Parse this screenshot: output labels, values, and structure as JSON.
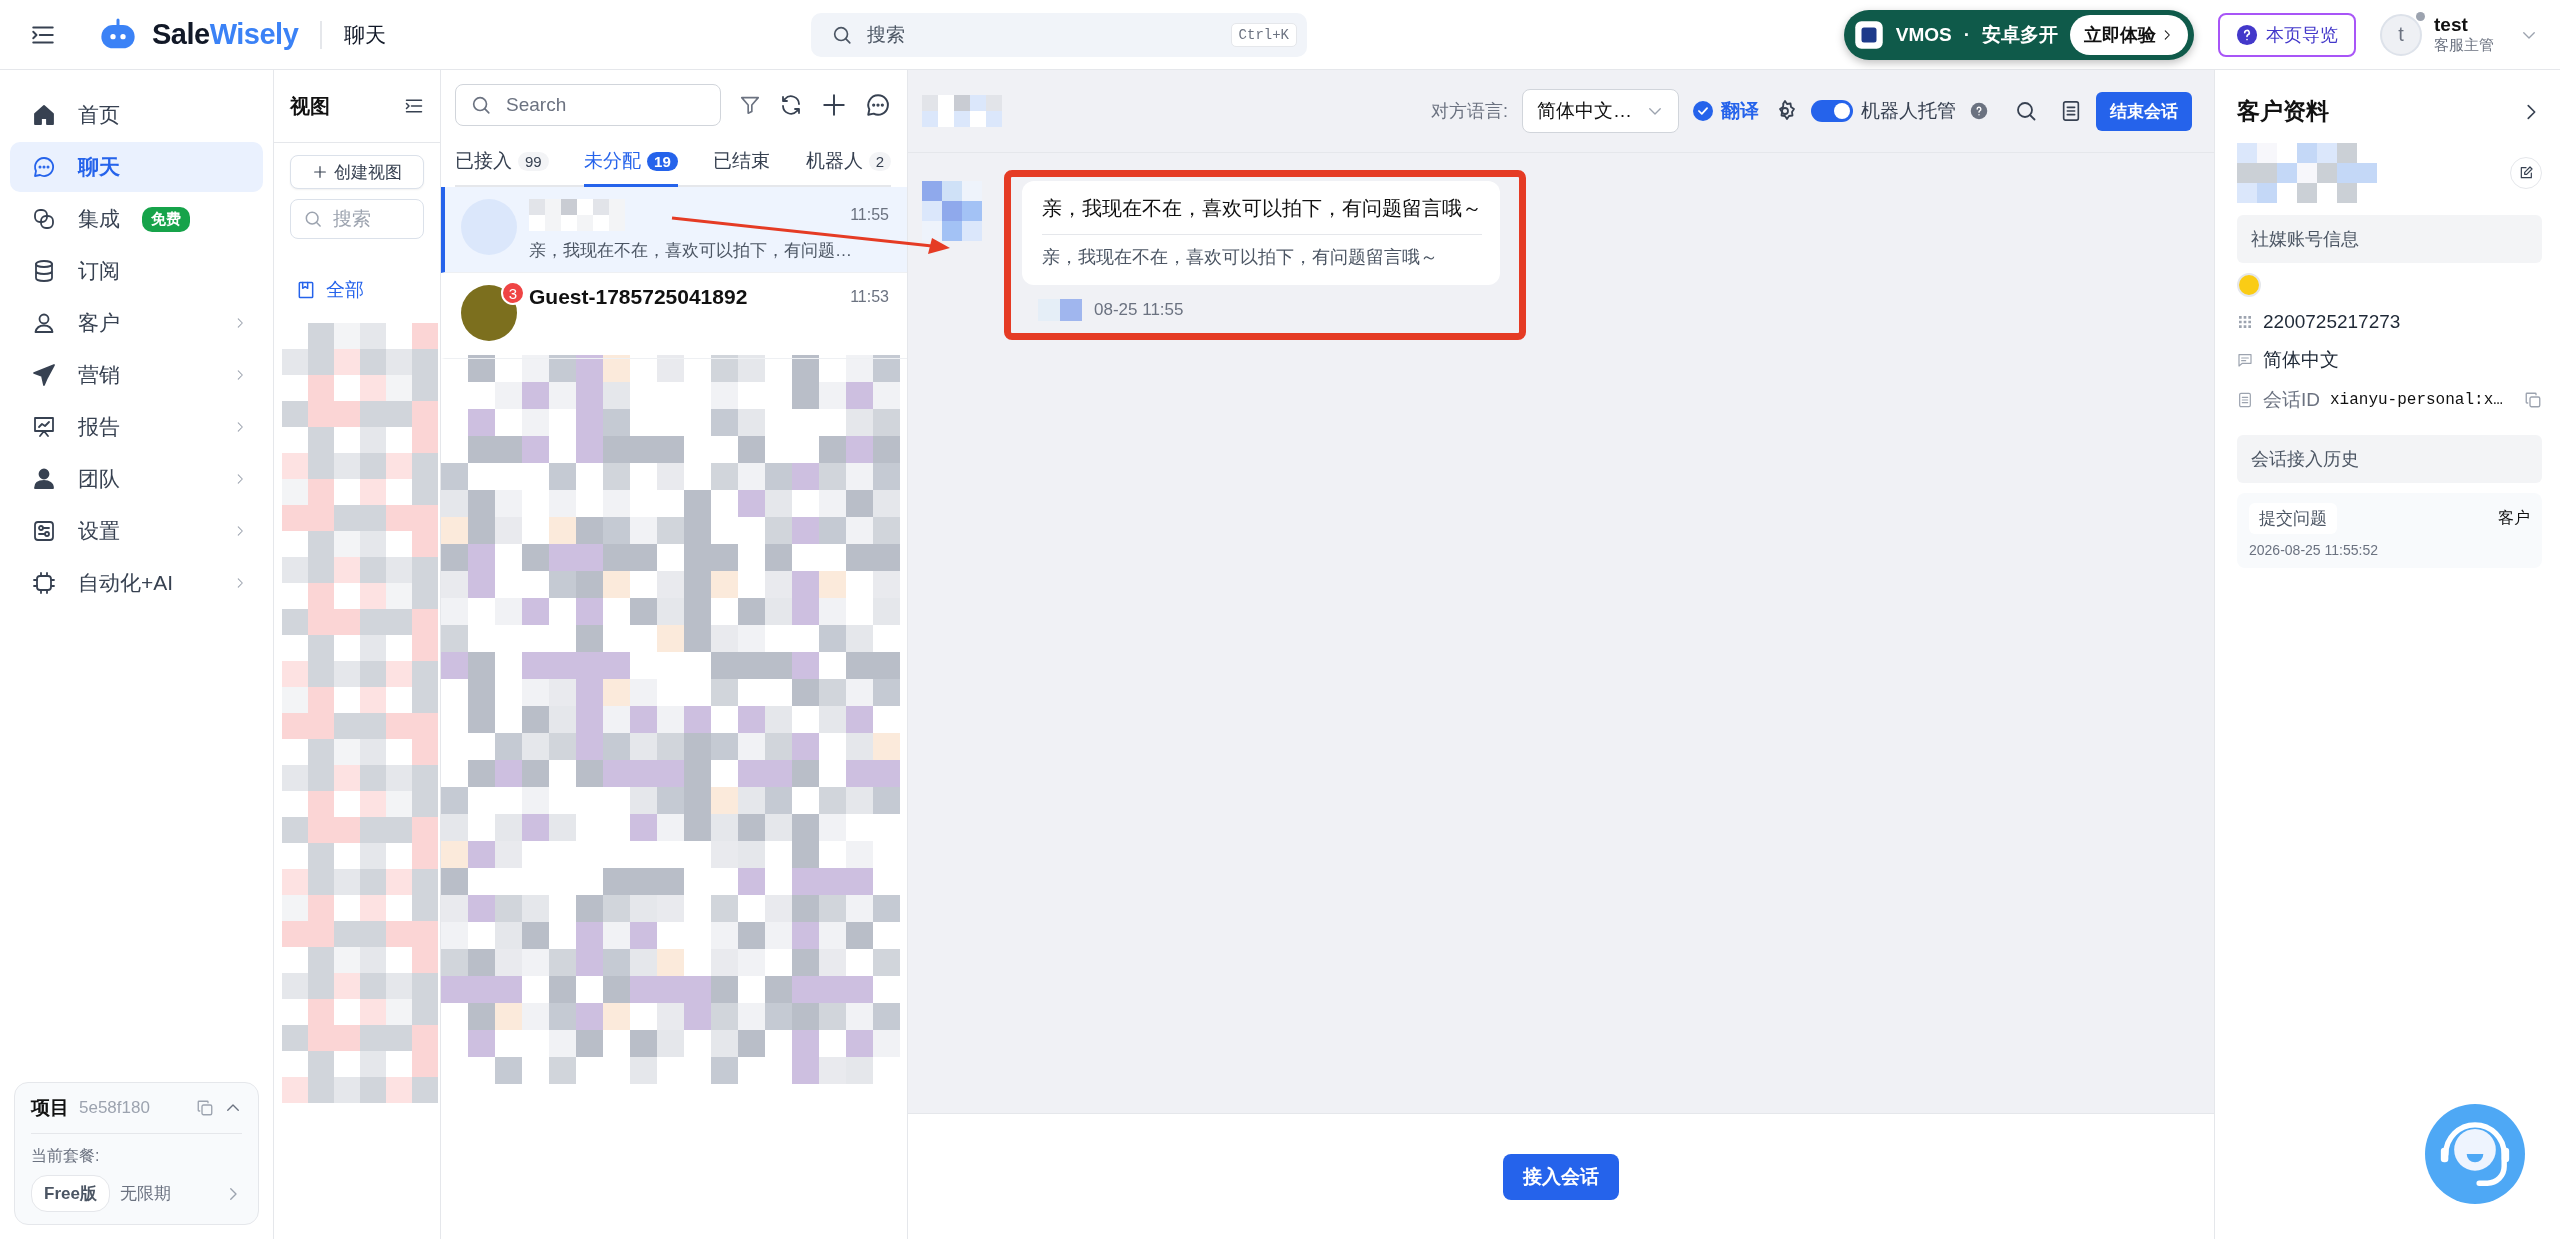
{
  "topbar": {
    "brand_first": "Sale",
    "brand_second": "Wisely",
    "page_title": "聊天",
    "search": {
      "placeholder": "搜索",
      "shortcut": "Ctrl+K"
    },
    "promo": {
      "brand": "VMOS",
      "separator": "·",
      "text": "安卓多开",
      "cta": "立即体验"
    },
    "guide_button": "本页导览",
    "user": {
      "avatar_letter": "t",
      "name": "test",
      "role": "客服主管"
    }
  },
  "nav": {
    "items": [
      {
        "kind": "home",
        "label": "首页",
        "selected": false,
        "expandable": false
      },
      {
        "kind": "chat",
        "label": "聊天",
        "selected": true,
        "expandable": false
      },
      {
        "kind": "link",
        "label": "集成",
        "selected": false,
        "expandable": false,
        "badge": "免费"
      },
      {
        "kind": "database",
        "label": "订阅",
        "selected": false,
        "expandable": false
      },
      {
        "kind": "user",
        "label": "客户",
        "selected": false,
        "expandable": true
      },
      {
        "kind": "send",
        "label": "营销",
        "selected": false,
        "expandable": true
      },
      {
        "kind": "report",
        "label": "报告",
        "selected": false,
        "expandable": true
      },
      {
        "kind": "team",
        "label": "团队",
        "selected": false,
        "expandable": true
      },
      {
        "kind": "settings",
        "label": "设置",
        "selected": false,
        "expandable": true
      },
      {
        "kind": "chip",
        "label": "自动化+AI",
        "selected": false,
        "expandable": true
      }
    ],
    "project": {
      "label": "项目",
      "id": "5e58f180",
      "plan_label": "当前套餐:",
      "plan": "Free版",
      "term": "无限期"
    }
  },
  "views": {
    "title": "视图",
    "create_button": "创建视图",
    "search": {
      "placeholder": "搜索"
    },
    "items": [
      {
        "label": "全部",
        "selected": true
      }
    ]
  },
  "chat_list": {
    "search": {
      "placeholder": "Search"
    },
    "tabs": [
      {
        "label": "已接入",
        "count": "99",
        "selected": false
      },
      {
        "label": "未分配",
        "count": "19",
        "selected": true
      },
      {
        "label": "已结束",
        "selected": false
      },
      {
        "label": "机器人",
        "count": "2",
        "selected": false
      }
    ],
    "conversations": [
      {
        "time": "11:55",
        "preview": "亲，我现在不在，喜欢可以拍下，有问题…",
        "selected": true
      },
      {
        "name": "Guest-1785725041892",
        "time": "11:53",
        "unread": "3",
        "selected": false
      }
    ]
  },
  "chat": {
    "language_label": "对方语言:",
    "language": "简体中文…",
    "translate": {
      "label": "翻译",
      "checked": true
    },
    "robot": {
      "label": "机器人托管",
      "on": true
    },
    "end_button": "结束会话",
    "messages": [
      {
        "text": "亲，我现在不在，喜欢可以拍下，有问题留言哦～",
        "translation": "亲，我现在不在，喜欢可以拍下，有问题留言哦～",
        "time": "08-25 11:55"
      }
    ],
    "join_button": "接入会话"
  },
  "customer": {
    "title": "客户资料",
    "social_section": "社媒账号信息",
    "account_id": "2200725217273",
    "language": "简体中文",
    "session_label": "会话ID",
    "session_id": "xianyu-personal:x…",
    "history_section": "会话接入历史",
    "history": [
      {
        "event": "提交问题",
        "actor": "客户",
        "time": "2026-08-25 11:55:52"
      }
    ]
  }
}
